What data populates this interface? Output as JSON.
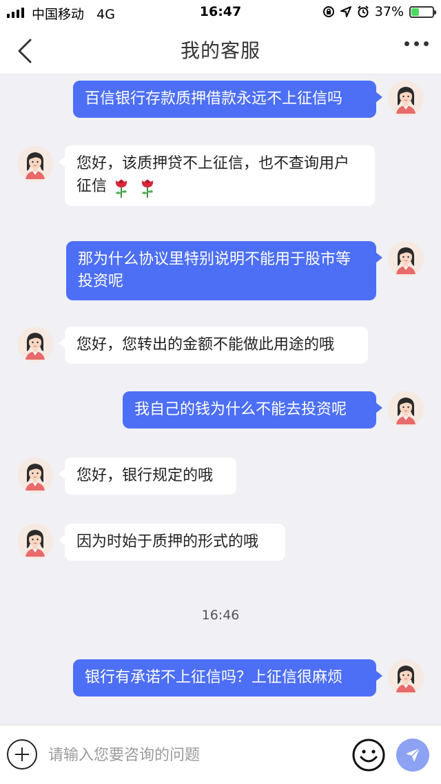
{
  "status_bar": {
    "carrier": "中国移动",
    "network": "4G",
    "time": "16:47",
    "battery_percent": "37%",
    "battery_level": 0.37
  },
  "nav": {
    "title": "我的客服"
  },
  "messages": [
    {
      "from": "user",
      "text": "百信银行存款质押借款永远不上征信吗"
    },
    {
      "from": "agent",
      "text": "您好，该质押贷不上征信，也不查询用户征信",
      "emoji": [
        "rose-icon",
        "rose-icon"
      ]
    },
    {
      "from": "user",
      "text": "那为什么协议里特别说明不能用于股市等投资呢"
    },
    {
      "from": "agent",
      "text": "您好，您转出的金额不能做此用途的哦"
    },
    {
      "from": "user",
      "text": "我自己的钱为什么不能去投资呢"
    },
    {
      "from": "agent",
      "text": "您好，银行规定的哦"
    },
    {
      "from": "agent",
      "text": "因为时始于质押的形式的哦"
    },
    {
      "from": "user",
      "text": "银行有承诺不上征信吗？上征信很麻烦"
    }
  ],
  "timestamp": "16:46",
  "input": {
    "placeholder": "请输入您要咨询的问题",
    "value": ""
  },
  "icons": [
    "back-icon",
    "more-icon",
    "plus-icon",
    "emoji-icon",
    "send-icon"
  ],
  "colors": {
    "accent": "#4d6ff6",
    "background": "#f0f0f5",
    "send_button": "#8da2f2"
  }
}
